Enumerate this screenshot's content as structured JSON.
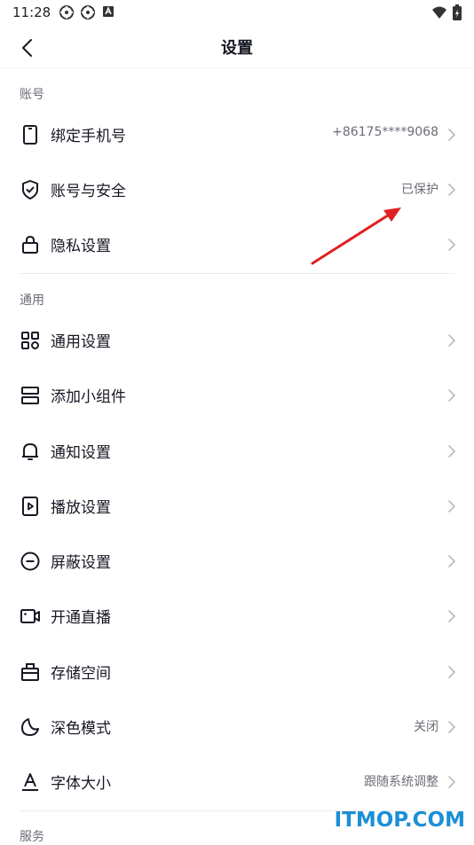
{
  "status_bar": {
    "time": "11:28"
  },
  "header": {
    "title": "设置"
  },
  "sections": [
    {
      "title": "账号",
      "items": [
        {
          "label": "绑定手机号",
          "value": "+86175****9068",
          "icon": "phone-icon"
        },
        {
          "label": "账号与安全",
          "value": "已保护",
          "icon": "shield-icon"
        },
        {
          "label": "隐私设置",
          "value": "",
          "icon": "lock-icon"
        }
      ]
    },
    {
      "title": "通用",
      "items": [
        {
          "label": "通用设置",
          "value": "",
          "icon": "grid-icon"
        },
        {
          "label": "添加小组件",
          "value": "",
          "icon": "widget-icon"
        },
        {
          "label": "通知设置",
          "value": "",
          "icon": "bell-icon"
        },
        {
          "label": "播放设置",
          "value": "",
          "icon": "play-icon"
        },
        {
          "label": "屏蔽设置",
          "value": "",
          "icon": "block-icon"
        },
        {
          "label": "开通直播",
          "value": "",
          "icon": "camera-icon"
        },
        {
          "label": "存储空间",
          "value": "",
          "icon": "storage-icon"
        },
        {
          "label": "深色模式",
          "value": "关闭",
          "icon": "moon-icon"
        },
        {
          "label": "字体大小",
          "value": "跟随系统调整",
          "icon": "font-icon"
        }
      ]
    },
    {
      "title": "服务",
      "items": []
    }
  ],
  "watermark": "ITMOP.COM",
  "colors": {
    "text": "#161823",
    "secondary": "#6b6d77",
    "annotation_arrow": "#e02020",
    "watermark": "#1b8fd6"
  }
}
